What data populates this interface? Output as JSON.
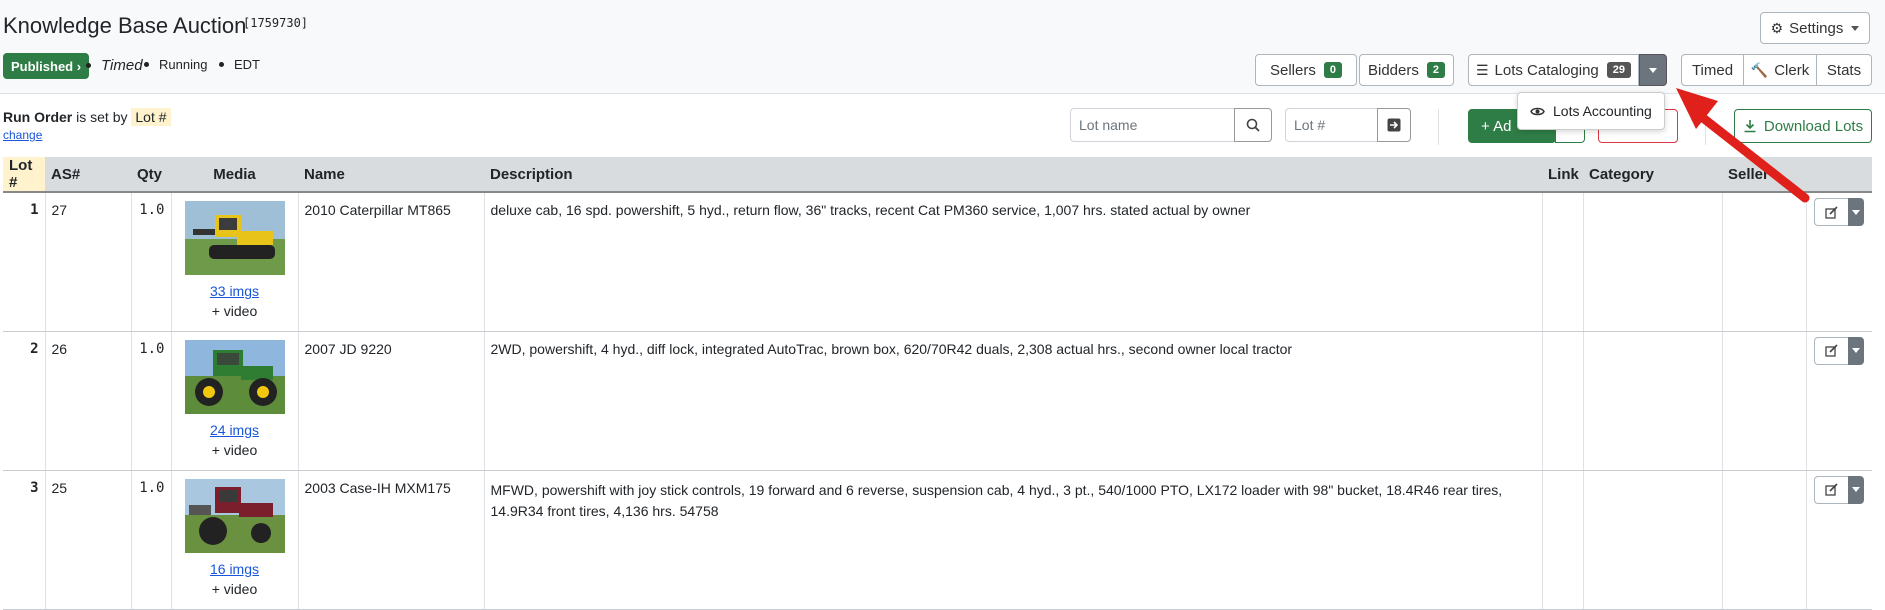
{
  "header": {
    "title": "Knowledge Base Auction",
    "auction_id": "[1759730]",
    "published_label": "Published ›",
    "status_items": [
      "Timed",
      "Running",
      "EDT"
    ],
    "settings_label": "Settings"
  },
  "nav": {
    "sellers_label": "Sellers",
    "sellers_count": "0",
    "bidders_label": "Bidders",
    "bidders_count": "2",
    "lots_cataloging_label": "Lots Cataloging",
    "lots_cataloging_count": "29",
    "timed_label": "Timed",
    "clerk_label": "Clerk",
    "stats_label": "Stats"
  },
  "dropdown": {
    "lots_accounting_label": "Lots Accounting"
  },
  "toolbar": {
    "run_order_label": "Run Order",
    "run_order_suffix": "is set by",
    "run_order_value": "Lot #",
    "change_link": "change",
    "lot_name_placeholder": "Lot name",
    "lot_number_placeholder": "Lot #",
    "add_label": "+ Ad",
    "download_label": "Download Lots"
  },
  "table": {
    "headers": {
      "lot": "Lot #",
      "as": "AS#",
      "qty": "Qty",
      "media": "Media",
      "name": "Name",
      "description": "Description",
      "link": "Link",
      "category": "Category",
      "seller": "Seller"
    },
    "rows": [
      {
        "lot": "1",
        "as": "27",
        "qty": "1.0",
        "imgs": "33 imgs",
        "video": "+ video",
        "name": "2010 Caterpillar MT865",
        "description": "deluxe cab, 16 spd. powershift, 5 hyd., return flow, 36\" tracks, recent Cat PM360 service, 1,007 hrs. stated actual by owner"
      },
      {
        "lot": "2",
        "as": "26",
        "qty": "1.0",
        "imgs": "24 imgs",
        "video": "+ video",
        "name": "2007 JD 9220",
        "description": "2WD, powershift, 4 hyd., diff lock, integrated AutoTrac, brown box, 620/70R42 duals, 2,308 actual hrs., second owner local tractor"
      },
      {
        "lot": "3",
        "as": "25",
        "qty": "1.0",
        "imgs": "16 imgs",
        "video": "+ video",
        "name": "2003 Case-IH MXM175",
        "description": "MFWD, powershift with joy stick controls, 19 forward and 6 reverse, suspension cab, 4 hyd., 3 pt., 540/1000 PTO, LX172 loader with 98\" bucket, 18.4R46 rear tires, 14.9R34 front tires, 4,136 hrs. 54758"
      }
    ]
  },
  "colors": {
    "primary_green": "#2f7d46",
    "arrow_red": "#e0201b",
    "link_blue": "#1a56db",
    "header_bg": "#d9dcdf",
    "highlight_yellow": "#fff3cd"
  }
}
